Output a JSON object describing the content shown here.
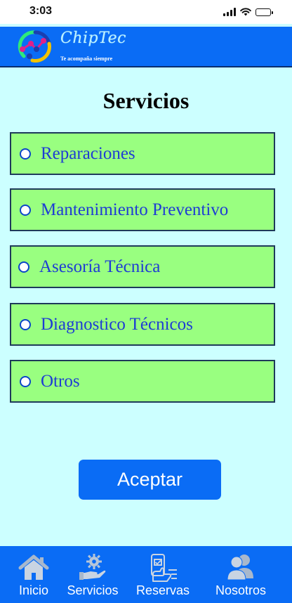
{
  "status_bar": {
    "time": "3:03"
  },
  "header": {
    "brand_name": "ChipTec",
    "tagline": "Te acompaña siempre"
  },
  "page": {
    "title": "Servicios"
  },
  "options": [
    {
      "label": "Reparaciones",
      "selected": false
    },
    {
      "label": "Mantenimiento Preventivo",
      "selected": false
    },
    {
      "label": "Asesoría Técnica",
      "selected": false
    },
    {
      "label": "Diagnostico Técnicos",
      "selected": false
    },
    {
      "label": "Otros",
      "selected": false
    }
  ],
  "actions": {
    "accept_label": "Aceptar"
  },
  "bottom_nav": {
    "items": [
      {
        "label": "Inicio",
        "icon": "home-icon"
      },
      {
        "label": "Servicios",
        "icon": "service-hand-gear-icon"
      },
      {
        "label": "Reservas",
        "icon": "booking-checklist-icon"
      },
      {
        "label": "Nosotros",
        "icon": "people-icon"
      }
    ]
  },
  "colors": {
    "background": "#ccffff",
    "header_blue": "#0a6cf5",
    "option_green": "#99ff80",
    "option_text": "#1e3cd4",
    "brand_text": "#bff2ff"
  }
}
